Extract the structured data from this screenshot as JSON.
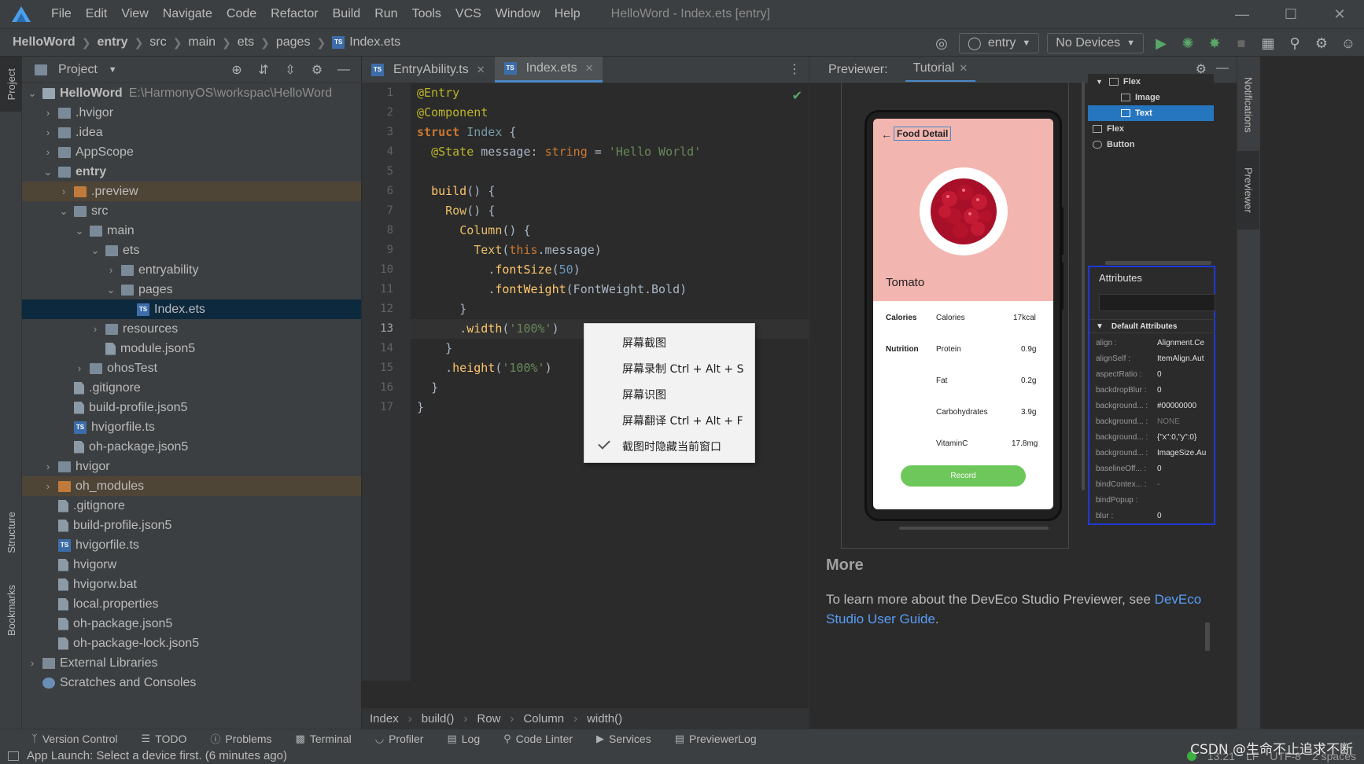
{
  "menubar": {
    "items": [
      "File",
      "Edit",
      "View",
      "Navigate",
      "Code",
      "Refactor",
      "Build",
      "Run",
      "Tools",
      "VCS",
      "Window",
      "Help"
    ],
    "window_title": "HelloWord - Index.ets [entry]"
  },
  "navbar": {
    "breadcrumb": [
      "HelloWord",
      "entry",
      "src",
      "main",
      "ets",
      "pages",
      "Index.ets"
    ],
    "module": "entry",
    "devices": "No Devices"
  },
  "left_stripe": {
    "project": "Project",
    "structure": "Structure",
    "bookmarks": "Bookmarks"
  },
  "project": {
    "title": "Project",
    "root_name": "HelloWord",
    "root_path": "E:\\HarmonyOS\\workspac\\HelloWord",
    "tree": [
      {
        "label": ".hvigor",
        "type": "folder"
      },
      {
        "label": ".idea",
        "type": "folder"
      },
      {
        "label": "AppScope",
        "type": "folder"
      },
      {
        "label": "entry",
        "type": "folder"
      },
      {
        "label": ".preview",
        "type": "folder"
      },
      {
        "label": "src",
        "type": "folder"
      },
      {
        "label": "main",
        "type": "folder"
      },
      {
        "label": "ets",
        "type": "folder"
      },
      {
        "label": "entryability",
        "type": "folder"
      },
      {
        "label": "pages",
        "type": "folder"
      },
      {
        "label": "Index.ets",
        "type": "ts"
      },
      {
        "label": "resources",
        "type": "folder"
      },
      {
        "label": "module.json5",
        "type": "file"
      },
      {
        "label": "ohosTest",
        "type": "folder"
      },
      {
        "label": ".gitignore",
        "type": "file"
      },
      {
        "label": "build-profile.json5",
        "type": "file"
      },
      {
        "label": "hvigorfile.ts",
        "type": "ts"
      },
      {
        "label": "oh-package.json5",
        "type": "file"
      },
      {
        "label": "hvigor",
        "type": "folder"
      },
      {
        "label": "oh_modules",
        "type": "folder"
      },
      {
        "label": ".gitignore",
        "type": "file"
      },
      {
        "label": "build-profile.json5",
        "type": "file"
      },
      {
        "label": "hvigorfile.ts",
        "type": "ts"
      },
      {
        "label": "hvigorw",
        "type": "file"
      },
      {
        "label": "hvigorw.bat",
        "type": "file"
      },
      {
        "label": "local.properties",
        "type": "file"
      },
      {
        "label": "oh-package.json5",
        "type": "file"
      },
      {
        "label": "oh-package-lock.json5",
        "type": "file"
      },
      {
        "label": "External Libraries",
        "type": "lib"
      },
      {
        "label": "Scratches and Consoles",
        "type": "scratch"
      }
    ]
  },
  "editor": {
    "tabs": [
      "EntryAbility.ts",
      "Index.ets"
    ],
    "active_tab": "Index.ets",
    "breadcrumb": [
      "Index",
      "build()",
      "Row",
      "Column",
      "width()"
    ],
    "current_line": 13
  },
  "context_menu": {
    "items": [
      "屏幕截图",
      "屏幕录制 Ctrl + Alt + S",
      "屏幕识图",
      "屏幕翻译 Ctrl + Alt + F",
      "截图时隐藏当前窗口"
    ],
    "checked_index": 4
  },
  "previewer": {
    "label": "Previewer:",
    "tab": "Tutorial",
    "screen": {
      "title": "Food Detail",
      "food_name": "Tomato",
      "rows": [
        {
          "section": "Calories",
          "name": "Calories",
          "value": "17kcal"
        },
        {
          "section": "Nutrition",
          "name": "Protein",
          "value": "0.9g"
        },
        {
          "section": "",
          "name": "Fat",
          "value": "0.2g"
        },
        {
          "section": "",
          "name": "Carbohydrates",
          "value": "3.9g"
        },
        {
          "section": "",
          "name": "VitaminC",
          "value": "17.8mg"
        }
      ],
      "button": "Record"
    },
    "component_tree": [
      "Flex",
      "Image",
      "Text",
      "Flex",
      "Button"
    ],
    "attributes": {
      "title": "Attributes",
      "section": "Default Attributes",
      "rows": [
        {
          "key": "align :",
          "value": "Alignment.Ce"
        },
        {
          "key": "alignSelf :",
          "value": "ItemAlign.Aut"
        },
        {
          "key": "aspectRatio :",
          "value": "0"
        },
        {
          "key": "backdropBlur :",
          "value": "0"
        },
        {
          "key": "background... :",
          "value": "#00000000"
        },
        {
          "key": "background... :",
          "value": "NONE"
        },
        {
          "key": "background... :",
          "value": "{\"x\":0,\"y\":0}"
        },
        {
          "key": "background... :",
          "value": "ImageSize.Au"
        },
        {
          "key": "baselineOff... :",
          "value": "0"
        },
        {
          "key": "bindContex... :",
          "value": "-"
        },
        {
          "key": "bindPopup :",
          "value": ""
        },
        {
          "key": "blur :",
          "value": "0"
        }
      ]
    },
    "more_title": "More",
    "more_text": "To learn more about the DevEco Studio Previewer, see ",
    "more_link": "DevEco Studio User Guide",
    "more_end": "."
  },
  "right_stripe": {
    "notifications": "Notifications",
    "previewer": "Previewer"
  },
  "bottom_tools": [
    "Version Control",
    "TODO",
    "Problems",
    "Terminal",
    "Profiler",
    "Log",
    "Code Linter",
    "Services",
    "PreviewerLog"
  ],
  "status": {
    "message": "App Launch: Select a device first. (6 minutes ago)",
    "position": "13:21",
    "line_sep": "LF",
    "encoding": "UTF-8",
    "indent": "2 spaces",
    "watermark": "CSDN @生命不止追求不断"
  }
}
